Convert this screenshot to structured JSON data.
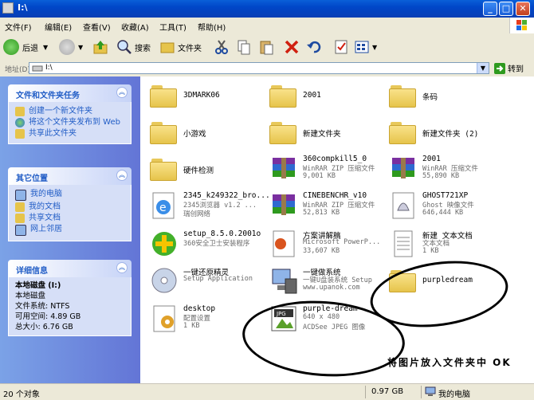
{
  "window": {
    "title": "I:\\"
  },
  "menu": [
    "文件(F)",
    "编辑(E)",
    "查看(V)",
    "收藏(A)",
    "工具(T)",
    "帮助(H)"
  ],
  "toolbar": {
    "back_label": "后退",
    "search_label": "搜索",
    "folders_label": "文件夹"
  },
  "address": {
    "label": "地址(D)",
    "value": "I:\\",
    "go_label": "转到"
  },
  "tasks": {
    "header": "文件和文件夹任务",
    "items": [
      "创建一个新文件夹",
      "将这个文件夹发布到 Web",
      "共享此文件夹"
    ]
  },
  "other_places": {
    "header": "其它位置",
    "items": [
      "我的电脑",
      "我的文档",
      "共享文档",
      "网上邻居"
    ]
  },
  "details": {
    "header": "详细信息",
    "name": "本地磁盘 (I:)",
    "type": "本地磁盘",
    "fs": "文件系统: NTFS",
    "free": "可用空间: 4.89 GB",
    "total": "总大小: 6.76 GB"
  },
  "files": [
    {
      "name": "3DMARK06",
      "kind": "folder"
    },
    {
      "name": "2001",
      "kind": "folder"
    },
    {
      "name": "条码",
      "kind": "folder"
    },
    {
      "name": "小游戏",
      "kind": "folder"
    },
    {
      "name": "新建文件夹",
      "kind": "folder"
    },
    {
      "name": "新建文件夹 (2)",
      "kind": "folder"
    },
    {
      "name": "硬件检测",
      "kind": "folder"
    },
    {
      "name": "360compkill5_0",
      "sub1": "WinRAR ZIP 压缩文件",
      "sub2": "9,001 KB",
      "kind": "rar"
    },
    {
      "name": "2001",
      "sub1": "WinRAR 压缩文件",
      "sub2": "55,890 KB",
      "kind": "rar"
    },
    {
      "name": "2345_k249322_bro...",
      "sub1": "2345浏览器 v1.2 ...",
      "sub2": "瑞创网络",
      "kind": "ie"
    },
    {
      "name": "CINEBENCHR_v10",
      "sub1": "WinRAR ZIP 压缩文件",
      "sub2": "52,813 KB",
      "kind": "rar"
    },
    {
      "name": "GHOST721XP",
      "sub1": "Ghost 映像文件",
      "sub2": "646,444 KB",
      "kind": "ghost"
    },
    {
      "name": "setup_8.5.0.2001o",
      "sub1": "360安全卫士安装程序",
      "sub2": "",
      "kind": "setup"
    },
    {
      "name": "方案讲解稿",
      "sub1": "Microsoft PowerP...",
      "sub2": "33,607 KB",
      "kind": "ppt"
    },
    {
      "name": "新建 文本文档",
      "sub1": "文本文档",
      "sub2": "1 KB",
      "kind": "txt"
    },
    {
      "name": "一键还原精灵",
      "sub1": "Setup Application",
      "sub2": "",
      "kind": "cd"
    },
    {
      "name": "一键做系统",
      "sub1": "一键U盘装系统 Setup",
      "sub2": "www.upanok.com",
      "kind": "pc"
    },
    {
      "name": "purpledream",
      "kind": "folder"
    },
    {
      "name": "desktop",
      "sub1": "配置设置",
      "sub2": "1 KB",
      "kind": "ini"
    },
    {
      "name": "purple-dream",
      "sub1": "640 x 480",
      "sub2": "ACDSee JPEG 图像",
      "kind": "jpg"
    }
  ],
  "annotation": "将图片放入文件夹中 OK",
  "status": {
    "count": "20 个对象",
    "size": "0.97 GB",
    "location": "我的电脑"
  }
}
